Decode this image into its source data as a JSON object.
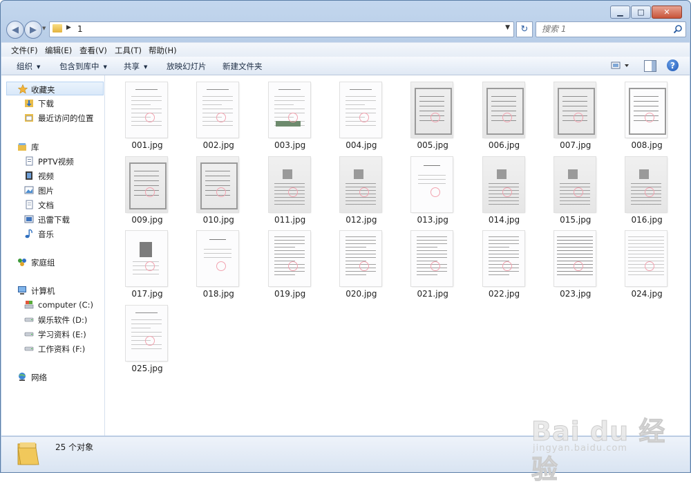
{
  "window": {
    "caption": {
      "minimize": "▁",
      "maximize": "□",
      "close": "✕"
    }
  },
  "address": {
    "path_segment": "1",
    "back_icon": "back-arrow-icon",
    "forward_icon": "forward-arrow-icon"
  },
  "search": {
    "placeholder": "搜索 1"
  },
  "menu": [
    "文件(F)",
    "编辑(E)",
    "查看(V)",
    "工具(T)",
    "帮助(H)"
  ],
  "commands": {
    "organize": "组织",
    "include_in_library": "包含到库中",
    "share": "共享",
    "slideshow": "放映幻灯片",
    "new_folder": "新建文件夹"
  },
  "nav": {
    "favorites": "收藏夹",
    "downloads": "下载",
    "recent": "最近访问的位置",
    "libraries": "库",
    "pptv": "PPTV视频",
    "videos": "视频",
    "pictures": "图片",
    "documents": "文档",
    "thunder": "迅雷下载",
    "music": "音乐",
    "homegroup": "家庭组",
    "computer": "计算机",
    "drive_c": "computer (C:)",
    "drive_d": "娱乐软件 (D:)",
    "drive_e": "学习资料 (E:)",
    "drive_f": "工作资料 (F:)",
    "network": "网络"
  },
  "files": [
    {
      "name": "001.jpg",
      "kind": "doc"
    },
    {
      "name": "002.jpg",
      "kind": "doc"
    },
    {
      "name": "003.jpg",
      "kind": "doc-photo"
    },
    {
      "name": "004.jpg",
      "kind": "doc"
    },
    {
      "name": "005.jpg",
      "kind": "cert"
    },
    {
      "name": "006.jpg",
      "kind": "cert"
    },
    {
      "name": "007.jpg",
      "kind": "cert"
    },
    {
      "name": "008.jpg",
      "kind": "license"
    },
    {
      "name": "009.jpg",
      "kind": "cert"
    },
    {
      "name": "010.jpg",
      "kind": "cert"
    },
    {
      "name": "011.jpg",
      "kind": "id"
    },
    {
      "name": "012.jpg",
      "kind": "id"
    },
    {
      "name": "013.jpg",
      "kind": "sparse"
    },
    {
      "name": "014.jpg",
      "kind": "id"
    },
    {
      "name": "015.jpg",
      "kind": "id"
    },
    {
      "name": "016.jpg",
      "kind": "id"
    },
    {
      "name": "017.jpg",
      "kind": "photo"
    },
    {
      "name": "018.jpg",
      "kind": "sparse"
    },
    {
      "name": "019.jpg",
      "kind": "text"
    },
    {
      "name": "020.jpg",
      "kind": "text"
    },
    {
      "name": "021.jpg",
      "kind": "text"
    },
    {
      "name": "022.jpg",
      "kind": "text"
    },
    {
      "name": "023.jpg",
      "kind": "table"
    },
    {
      "name": "024.jpg",
      "kind": "table-light"
    },
    {
      "name": "025.jpg",
      "kind": "doc"
    }
  ],
  "status": {
    "count_text": "25 个对象"
  },
  "watermark": {
    "brand": "Bai du 经验",
    "url": "jingyan.baidu.com"
  },
  "colors": {
    "accent": "#2d5fa3",
    "stamp": "#f2a3b0",
    "folder": "#e9bd4b"
  }
}
